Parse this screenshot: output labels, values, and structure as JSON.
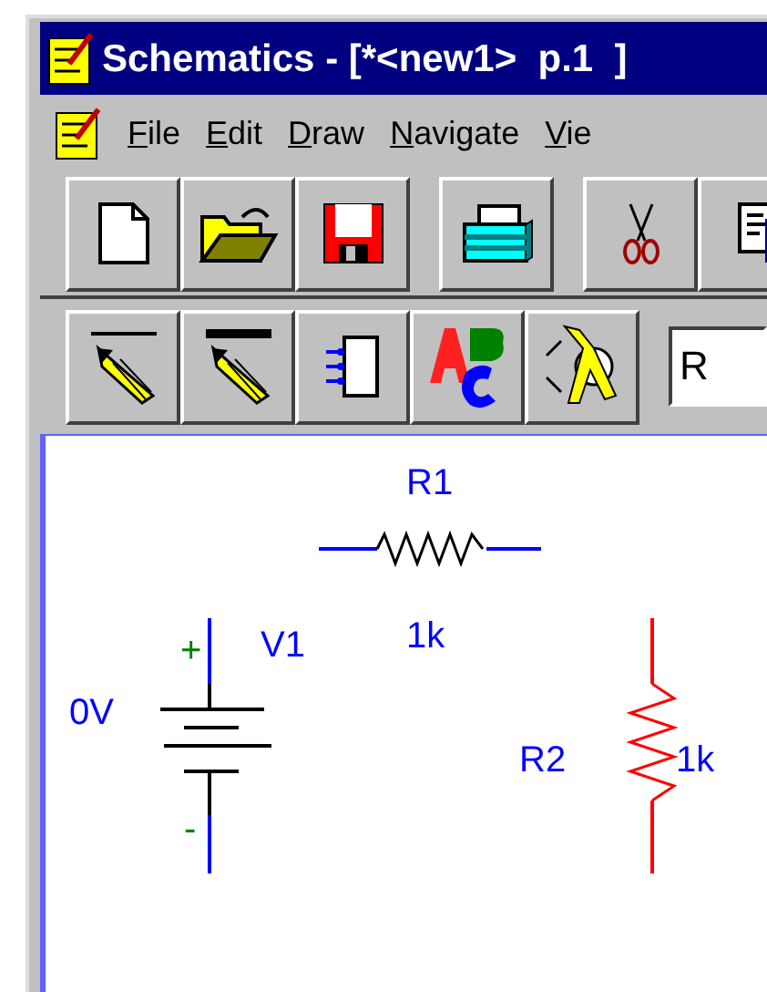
{
  "window": {
    "title": "Schematics - [*<new1>  p.1  ]"
  },
  "menu": [
    {
      "label": "File",
      "underline_first": true
    },
    {
      "label": "Edit",
      "underline_first": true
    },
    {
      "label": "Draw",
      "underline_first": true
    },
    {
      "label": "Navigate",
      "underline_first": true
    },
    {
      "label": "Vie",
      "underline_first": true
    }
  ],
  "toolbar_1": [
    {
      "kind": "new"
    },
    {
      "kind": "open"
    },
    {
      "kind": "save"
    },
    {
      "kind": "print"
    },
    {
      "kind": "cut"
    },
    {
      "kind": "copy"
    }
  ],
  "toolbar_2": [
    {
      "kind": "wire"
    },
    {
      "kind": "bus"
    },
    {
      "kind": "block"
    },
    {
      "kind": "text"
    },
    {
      "kind": "part"
    }
  ],
  "part_field": {
    "value": "R"
  },
  "schematic": [
    {
      "kind": "resistor_h",
      "selected": false,
      "name": "R1",
      "value": "1k"
    },
    {
      "kind": "battery",
      "selected": false,
      "name": "V1",
      "value": "0V",
      "plus": "+",
      "minus": "-"
    },
    {
      "kind": "resistor_v",
      "selected": true,
      "name": "R2",
      "value": "1k"
    }
  ]
}
